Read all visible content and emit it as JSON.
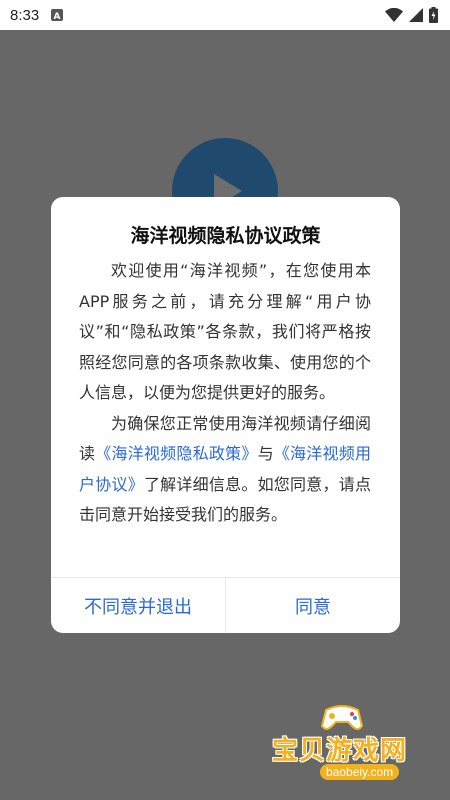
{
  "status_bar": {
    "time": "8:33",
    "notification_icon": "a-square-icon",
    "icons": [
      "wifi-icon",
      "signal-icon",
      "battery-charging-icon"
    ]
  },
  "dialog": {
    "title": "海洋视频隐私协议政策",
    "paragraph1": "欢迎使用“海洋视频”，在您使用本APP服务之前，请充分理解“用户协议”和“隐私政策”各条款，我们将严格按照经您同意的各项条款收集、使用您的个人信息，以便为您提供更好的服务。",
    "paragraph2_prefix": "为确保您正常使用海洋视频请仔细阅读",
    "privacy_link": "《海洋视频隐私政策》",
    "paragraph2_and": "与",
    "user_agreement_link": "《海洋视频用户协议》",
    "paragraph2_suffix": "了解详细信息。如您同意，请点击同意开始接受我们的服务。",
    "decline_button": "不同意并退出",
    "agree_button": "同意"
  },
  "watermark": {
    "text": "宝贝游戏网",
    "url": "baobeiy.com"
  },
  "colors": {
    "accent": "#2a6ad8",
    "overlay": "#676767",
    "logo": "#1f4a6e",
    "watermark": "#f1b21e"
  }
}
